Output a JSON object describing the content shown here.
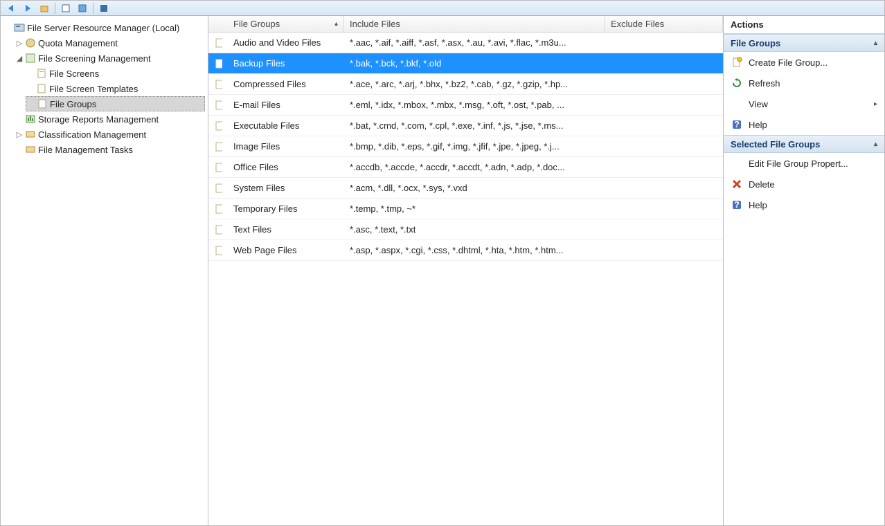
{
  "toolbar": {
    "btn_back": "back",
    "btn_forward": "forward",
    "btn_up": "up",
    "btn_refresh": "refresh",
    "btn_prop": "properties",
    "btn_help": "help"
  },
  "tree": {
    "root": "File Server Resource Manager (Local)",
    "quota": "Quota Management",
    "screening": "File Screening Management",
    "screens": "File Screens",
    "templates": "File Screen Templates",
    "groups": "File Groups",
    "reports": "Storage Reports Management",
    "classification": "Classification Management",
    "tasks": "File Management Tasks"
  },
  "columns": {
    "c0": "",
    "c1": "File Groups",
    "c2": "Include Files",
    "c3": "Exclude Files"
  },
  "rows": [
    {
      "name": "Audio and Video Files",
      "include": "*.aac, *.aif, *.aiff, *.asf, *.asx, *.au, *.avi, *.flac, *.m3u...",
      "exclude": "",
      "selected": false
    },
    {
      "name": "Backup Files",
      "include": "*.bak, *.bck, *.bkf, *.old",
      "exclude": "",
      "selected": true
    },
    {
      "name": "Compressed Files",
      "include": "*.ace, *.arc, *.arj, *.bhx, *.bz2, *.cab, *.gz, *.gzip, *.hp...",
      "exclude": "",
      "selected": false
    },
    {
      "name": "E-mail Files",
      "include": "*.eml, *.idx, *.mbox, *.mbx, *.msg, *.oft, *.ost, *.pab, ...",
      "exclude": "",
      "selected": false
    },
    {
      "name": "Executable Files",
      "include": "*.bat, *.cmd, *.com, *.cpl, *.exe, *.inf, *.js, *.jse, *.ms...",
      "exclude": "",
      "selected": false
    },
    {
      "name": "Image Files",
      "include": "*.bmp, *.dib, *.eps, *.gif, *.img, *.jfif, *.jpe, *.jpeg, *.j...",
      "exclude": "",
      "selected": false
    },
    {
      "name": "Office Files",
      "include": "*.accdb, *.accde, *.accdr, *.accdt, *.adn, *.adp, *.doc...",
      "exclude": "",
      "selected": false
    },
    {
      "name": "System Files",
      "include": "*.acm, *.dll, *.ocx, *.sys, *.vxd",
      "exclude": "",
      "selected": false
    },
    {
      "name": "Temporary Files",
      "include": "*.temp, *.tmp, ~*",
      "exclude": "",
      "selected": false
    },
    {
      "name": "Text Files",
      "include": "*.asc, *.text, *.txt",
      "exclude": "",
      "selected": false
    },
    {
      "name": "Web Page Files",
      "include": "*.asp, *.aspx, *.cgi, *.css, *.dhtml, *.hta, *.htm, *.htm...",
      "exclude": "",
      "selected": false
    }
  ],
  "actions": {
    "title": "Actions",
    "section1": "File Groups",
    "create": "Create File Group...",
    "refresh": "Refresh",
    "view": "View",
    "help": "Help",
    "section2": "Selected File Groups",
    "edit": "Edit File Group Propert...",
    "delete": "Delete",
    "help2": "Help"
  }
}
